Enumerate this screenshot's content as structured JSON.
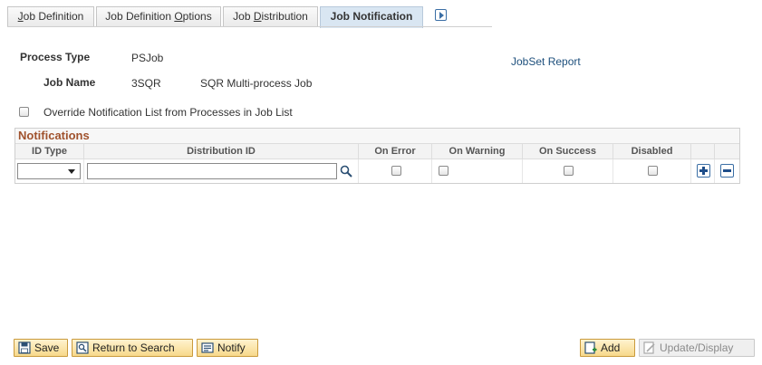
{
  "tabs": [
    {
      "label": "Job Definition",
      "underline": "J",
      "rest": "ob Definition",
      "active": false
    },
    {
      "label": "Job Definition Options",
      "pre": "Job Definition ",
      "underline": "O",
      "rest": "ptions",
      "active": false
    },
    {
      "label": "Job Distribution",
      "pre": "Job ",
      "underline": "D",
      "rest": "istribution",
      "active": false
    },
    {
      "label": "Job Notification",
      "active": true
    }
  ],
  "header": {
    "process_type_label": "Process Type",
    "process_type_value": "PSJob",
    "job_name_label": "Job Name",
    "job_name_value": "3SQR",
    "job_description": "SQR Multi-process Job",
    "jobset_report_link": "JobSet Report",
    "override_label": "Override Notification List from Processes in Job List",
    "override_checked": false
  },
  "notifications": {
    "title": "Notifications",
    "columns": [
      "ID Type",
      "Distribution ID",
      "On Error",
      "On Warning",
      "On Success",
      "Disabled"
    ],
    "row": {
      "id_type": "",
      "distribution_id": "",
      "on_error": false,
      "on_warning": false,
      "on_success": false,
      "disabled": false
    }
  },
  "toolbar": {
    "save_label": "Save",
    "return_label": "Return to Search",
    "notify_label": "Notify",
    "add_label": "Add",
    "update_label": "Update/Display"
  },
  "colors": {
    "active_tab_bg": "#d9e6f2",
    "grid_title": "#a0522d",
    "link": "#1d4f7c",
    "button_bg": "#f7d98b",
    "button_border": "#c99a3c"
  }
}
